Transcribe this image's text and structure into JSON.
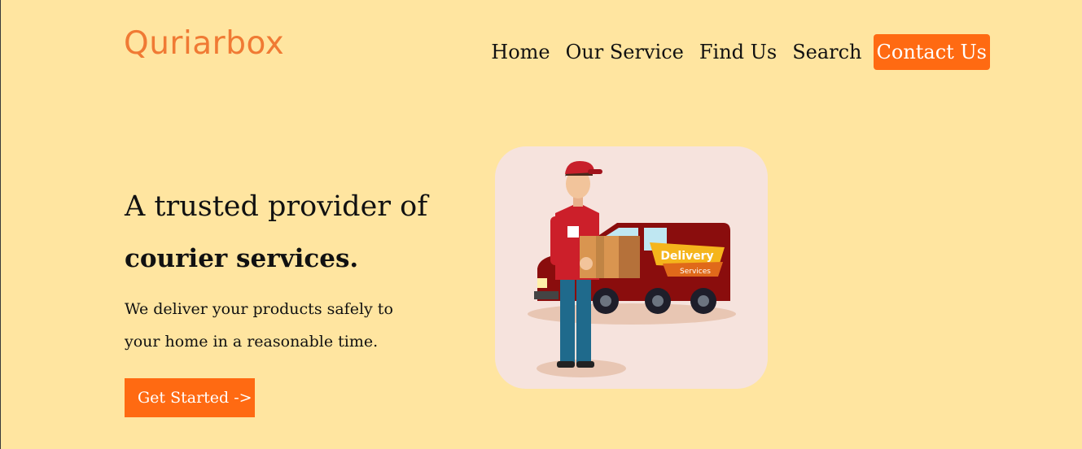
{
  "brand": {
    "logo_text": "Quriarbox"
  },
  "nav": {
    "items": [
      "Home",
      "Our Service",
      "Find Us",
      "Search"
    ],
    "contact": "Contact Us"
  },
  "hero": {
    "line1": "A trusted provider of",
    "line2": "courier services.",
    "description": "We deliver your products safely to your home in a reasonable time.",
    "button": "Get Started ->"
  },
  "illustration": {
    "van_sign_main": "Delivery",
    "van_sign_sub": "Services"
  },
  "colors": {
    "background": "#ffe5a0",
    "accent": "#ff6a12",
    "logo": "#f07a34",
    "illustration_bg": "#f6e3dd"
  }
}
